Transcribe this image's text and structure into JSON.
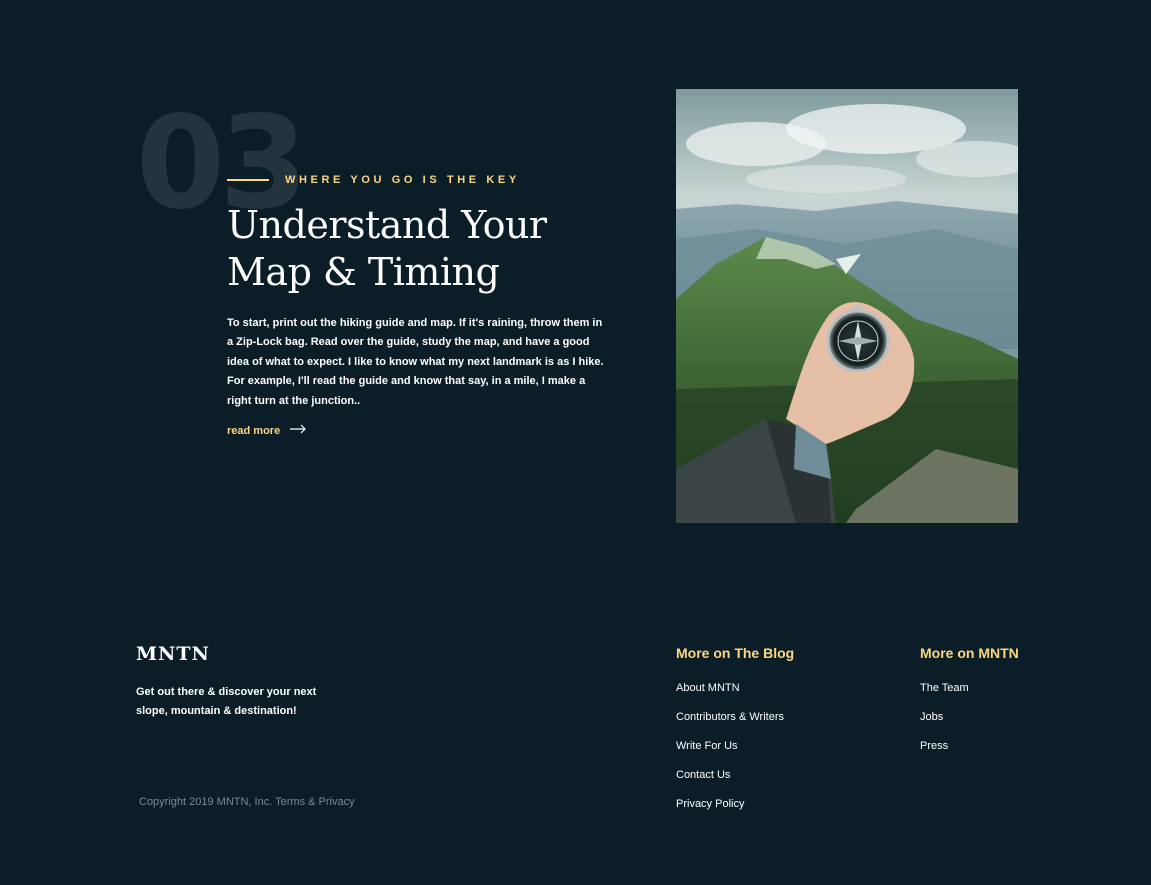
{
  "section": {
    "number": "03",
    "eyebrow": "WHERE YOU GO IS THE KEY",
    "title_line1": "Understand Your",
    "title_line2": "Map & Timing",
    "body": "To start, print out the hiking guide and map. If it's raining, throw them in a Zip-Lock bag. Read over the guide, study the map, and have a good idea of what to expect. I like to know what my next landmark is as I hike. For example, I'll read the guide and know that say, in a mile, I make a right turn at the junction..",
    "read_more": "read more",
    "icons": {
      "read_more": "arrow-right-icon"
    },
    "image_subject": "hand-holding-compass-mountains"
  },
  "footer": {
    "logo": "MNTN",
    "tagline": "Get out there & discover your next slope, mountain & destination!",
    "copyright": "Copyright 2019 MNTN, Inc. Terms & Privacy",
    "blog": {
      "heading": "More on The Blog",
      "links": [
        "About MNTN",
        "Contributors & Writers",
        "Write For Us",
        "Contact Us",
        "Privacy Policy"
      ]
    },
    "mntn": {
      "heading": "More on MNTN",
      "links": [
        "The Team",
        "Jobs",
        "Press"
      ]
    }
  },
  "colors": {
    "background": "#0b1d26",
    "accent": "#fbd784",
    "text": "#ffffff"
  }
}
